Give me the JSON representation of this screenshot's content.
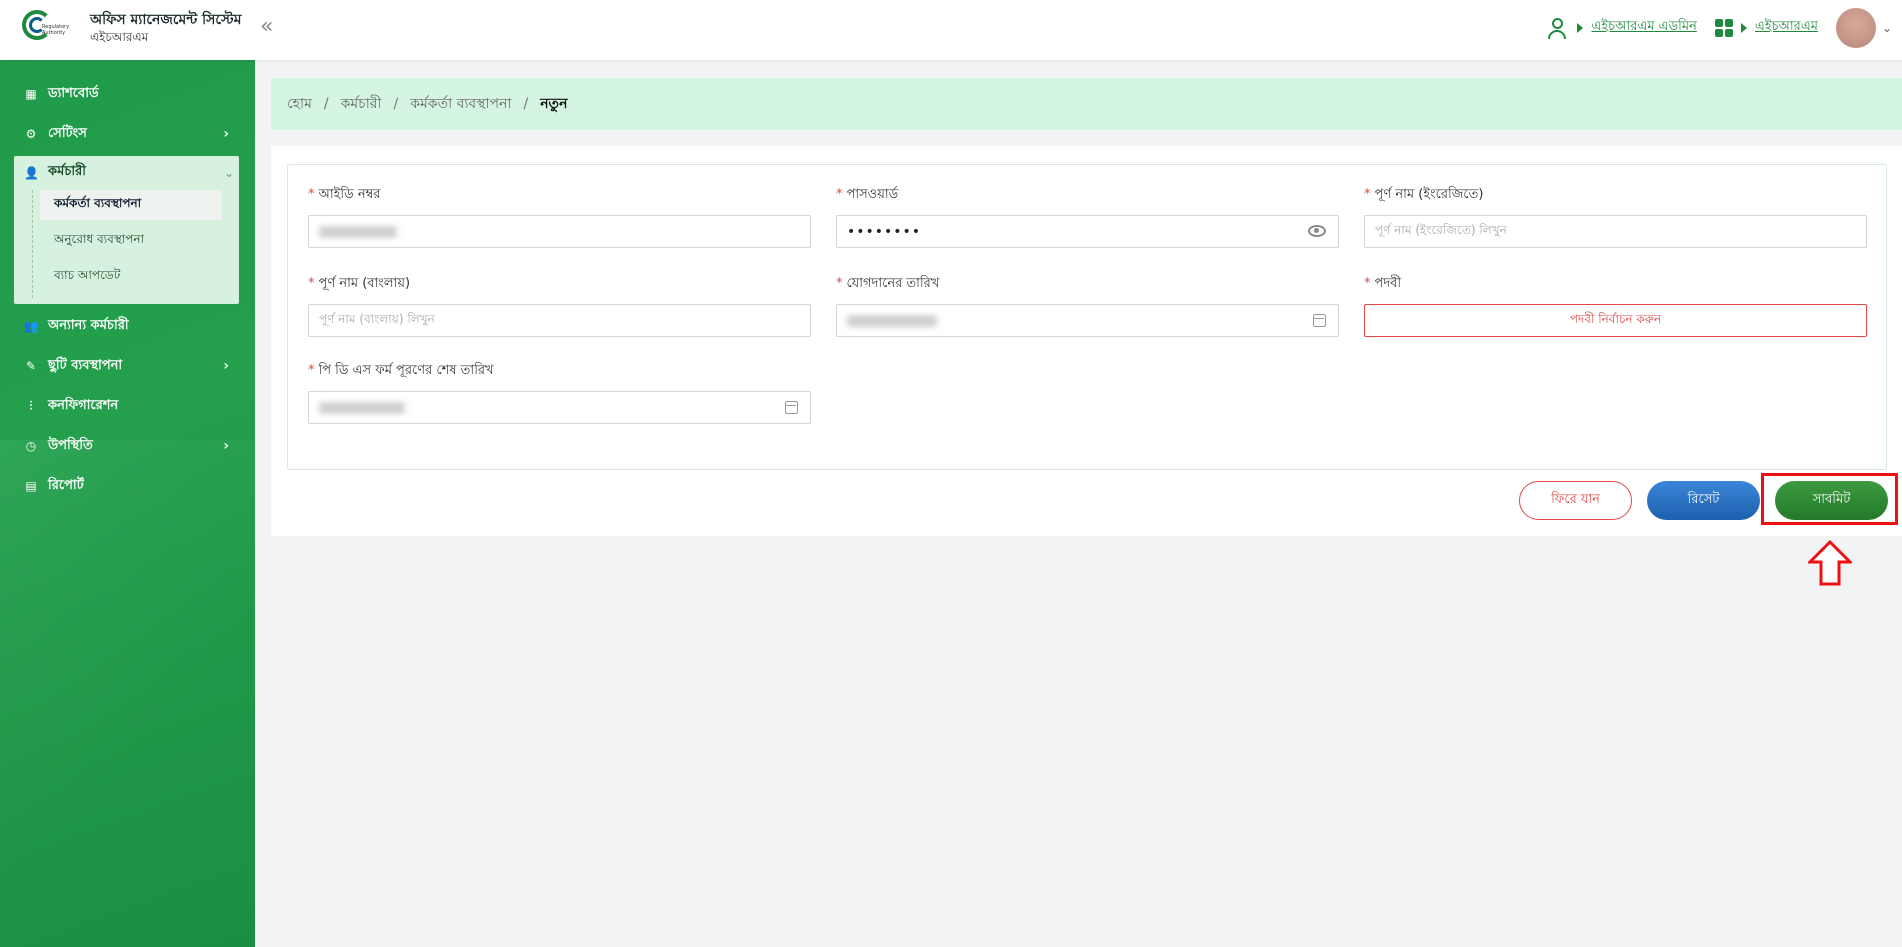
{
  "header": {
    "app_title": "অফিস ম্যানেজমেন্ট সিস্টেম",
    "app_subtitle": "এইচআরএম",
    "logo_text": "Regulatory Authority",
    "collapse_icon": "double-chevron-left-icon",
    "role_link": "এইচআরএম এডমিন",
    "module_link": "এইচআরএম"
  },
  "sidebar": {
    "items": [
      {
        "label": "ড্যাশবোর্ড",
        "icon": "dashboard-icon"
      },
      {
        "label": "সেটিংস",
        "icon": "gear-icon"
      },
      {
        "label": "কর্মচারী",
        "icon": "user-icon"
      },
      {
        "label": "অন্যান্য কর্মচারী",
        "icon": "users-icon"
      },
      {
        "label": "ছুটি ব্যবস্থাপনা",
        "icon": "leaf-icon"
      },
      {
        "label": "কনফিগারেশন",
        "icon": "sliders-icon"
      },
      {
        "label": "উপস্থিতি",
        "icon": "clock-icon"
      },
      {
        "label": "রিপোর্ট",
        "icon": "file-icon"
      }
    ],
    "employee_sub": [
      {
        "label": "কর্মকর্তা ব্যবস্থাপনা",
        "active": true
      },
      {
        "label": "অনুরোধ ব্যবস্থাপনা",
        "active": false
      },
      {
        "label": "ব্যাচ আপডেট",
        "active": false
      }
    ]
  },
  "breadcrumb": {
    "home": "হোম",
    "employee": "কর্মচারী",
    "officer_mgmt": "কর্মকর্তা ব্যবস্থাপনা",
    "current": "নতুন"
  },
  "form": {
    "id_label": "আইডি নম্বর",
    "password_label": "পাসওয়ার্ড",
    "password_value": "••••••••",
    "name_en_label": "পূর্ণ নাম (ইংরেজিতে)",
    "name_en_placeholder": "পূর্ণ নাম (ইংরেজিতে) লিখুন",
    "name_bn_label": "পূর্ণ নাম (বাংলায়)",
    "name_bn_placeholder": "পূর্ণ নাম (বাংলায়) লিখুন",
    "join_date_label": "যোগদানের তারিখ",
    "designation_label": "পদবী",
    "designation_placeholder": "পদবী নির্বাচন করুন",
    "pds_label": "পি ডি এস ফর্ম পূরণের শেষ তারিখ"
  },
  "buttons": {
    "back": "ফিরে যান",
    "reset": "রিসেট",
    "submit": "সাবমিট"
  },
  "colors": {
    "sidebar_green": "#22a04d",
    "breadcrumb_bg": "#d4f5e0",
    "error_red": "#e04848",
    "reset_blue": "#1e5fae",
    "submit_green": "#237a2b",
    "highlight_red": "#ee1111"
  }
}
